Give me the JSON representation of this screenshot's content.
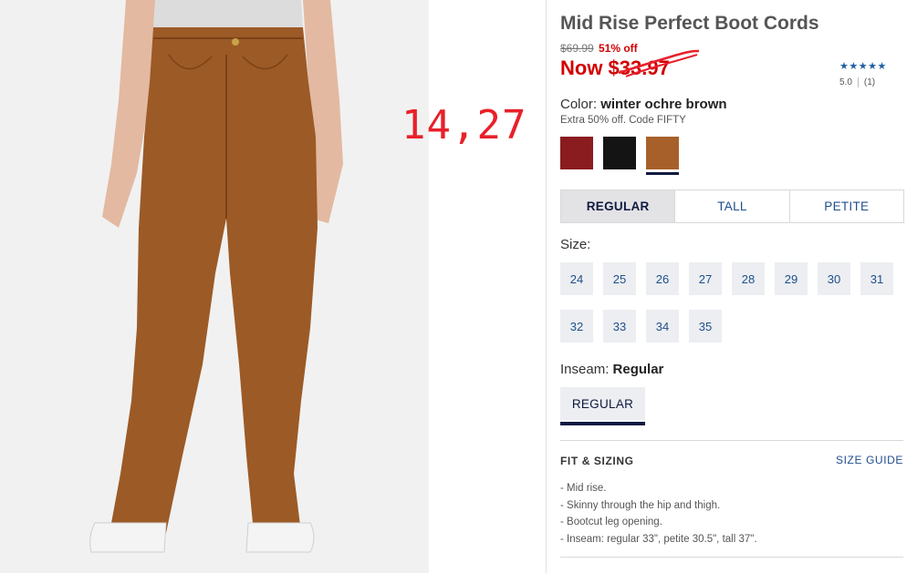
{
  "annotation": {
    "text": "14,27",
    "color": "#e8202a"
  },
  "product": {
    "title": "Mid Rise Perfect Boot Cords",
    "original_price": "$69.99",
    "discount": "51% off",
    "now_price": "Now $33.97"
  },
  "rating": {
    "stars": "★★★★★",
    "score": "5.0",
    "count": "(1)"
  },
  "color": {
    "label": "Color:",
    "value": "winter ochre brown",
    "promo": "Extra 50% off. Code FIFTY",
    "swatches": [
      {
        "name": "burgundy",
        "hex": "#8a1c20"
      },
      {
        "name": "black",
        "hex": "#141414"
      },
      {
        "name": "winter ochre brown",
        "hex": "#a8602a",
        "selected": true
      }
    ]
  },
  "fit_tabs": [
    "REGULAR",
    "TALL",
    "PETITE"
  ],
  "size": {
    "label": "Size:",
    "options": [
      "24",
      "25",
      "26",
      "27",
      "28",
      "29",
      "30",
      "31",
      "32",
      "33",
      "34",
      "35"
    ]
  },
  "inseam": {
    "label": "Inseam:",
    "value": "Regular",
    "option": "REGULAR"
  },
  "fit_sizing": {
    "heading": "FIT & SIZING",
    "size_guide": "SIZE GUIDE",
    "details": [
      "Mid rise.",
      "Skinny through the hip and thigh.",
      "Bootcut leg opening.",
      "Inseam: regular 33\", petite 30.5\", tall 37\"."
    ]
  }
}
